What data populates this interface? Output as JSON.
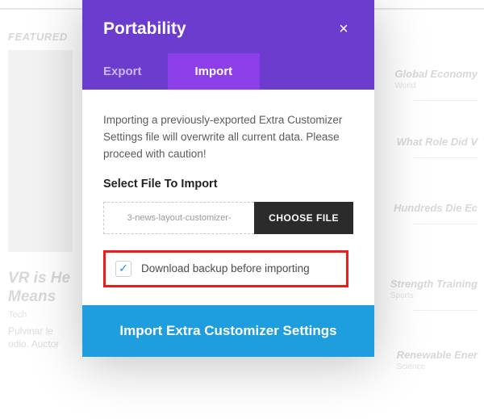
{
  "background": {
    "featured_label": "FEATURED",
    "main_article": {
      "title_l1": "VR is He",
      "title_l2": "Means",
      "meta": "Tech",
      "body_l1": "Pulvinar le",
      "body_l2": "odio. Auctor"
    },
    "side": [
      {
        "title": "Global Economy",
        "cat": "World"
      },
      {
        "title": "What Role Did V",
        "cat": ""
      },
      {
        "title": "Hundreds Die Ec",
        "cat": ""
      },
      {
        "title": "Strength Training",
        "cat": "Sports"
      },
      {
        "title": "Renewable Ener",
        "cat": "Science"
      }
    ]
  },
  "modal": {
    "title": "Portability",
    "tabs": {
      "export": "Export",
      "import": "Import"
    },
    "import": {
      "description": "Importing a previously-exported Extra Customizer Settings file will overwrite all current data. Please proceed with caution!",
      "select_label": "Select File To Import",
      "file_name": "3-news-layout-customizer-",
      "choose_file": "CHOOSE FILE",
      "backup_label": "Download backup before importing"
    },
    "action": "Import Extra Customizer Settings"
  }
}
